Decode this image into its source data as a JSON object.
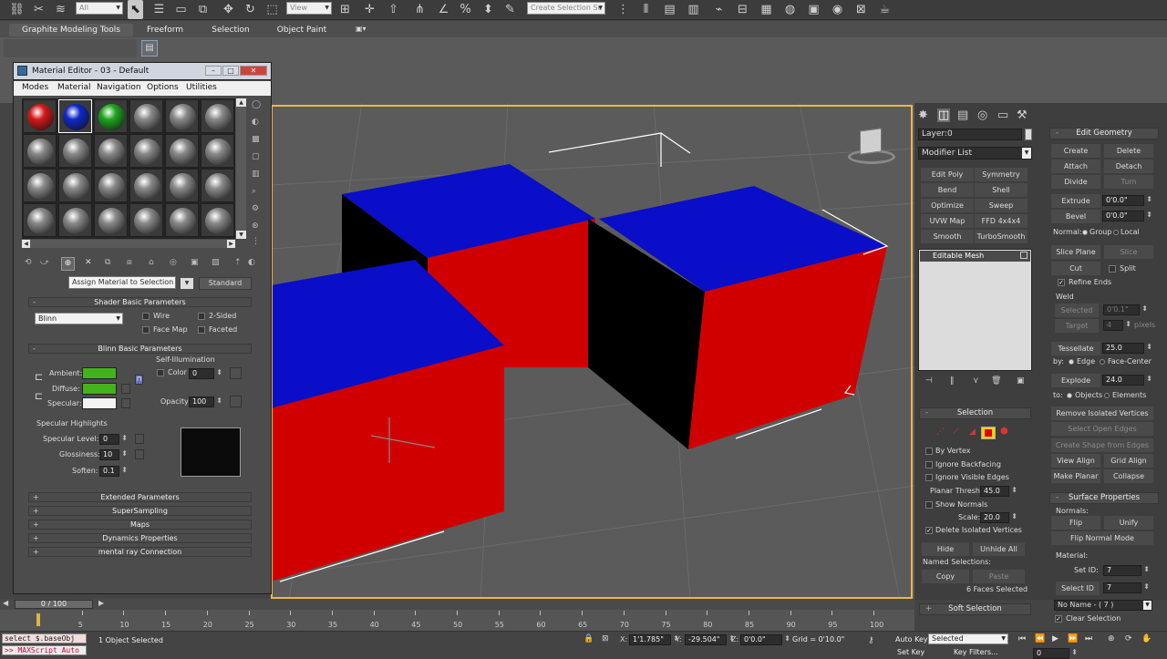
{
  "toolbar": {
    "selection_filter": "All",
    "ref_coord": "View",
    "named_selection": "Create Selection Se"
  },
  "ribbon": {
    "tabs": [
      "Graphite Modeling Tools",
      "Freeform",
      "Selection",
      "Object Paint"
    ]
  },
  "material_editor": {
    "title": "Material Editor - 03 - Default",
    "menu": [
      "Modes",
      "Material",
      "Navigation",
      "Options",
      "Utilities"
    ],
    "slot_colors": [
      "#d41a1a",
      "#1028c8",
      "#1ea81e"
    ],
    "tooltip": "Assign Material to Selection",
    "material_type": "Standard",
    "shader_params": {
      "header": "Shader Basic Parameters",
      "shader": "Blinn",
      "wire": "Wire",
      "two_sided": "2-Sided",
      "face_map": "Face Map",
      "faceted": "Faceted"
    },
    "blinn_params": {
      "header": "Blinn Basic Parameters",
      "self_illum": "Self-Illumination",
      "color_label": "Color",
      "color_value": "0",
      "ambient": "Ambient:",
      "diffuse": "Diffuse:",
      "specular": "Specular:",
      "opacity_label": "Opacity:",
      "opacity_value": "100",
      "ambient_color": "#44b21b",
      "diffuse_color": "#44b21b",
      "specular_color": "#f2f2f2"
    },
    "specular_highlights": {
      "header": "Specular Highlights",
      "level_label": "Specular Level:",
      "level_value": "0",
      "gloss_label": "Glossiness:",
      "gloss_value": "10",
      "soften_label": "Soften:",
      "soften_value": "0.1"
    },
    "rollouts": [
      "Extended Parameters",
      "SuperSampling",
      "Maps",
      "Dynamics Properties",
      "mental ray Connection"
    ]
  },
  "command_panel": {
    "layer": "Layer:0",
    "modifier_list": "Modifier List",
    "modifier_buttons": [
      "Edit Poly",
      "Symmetry",
      "Bend",
      "Shell",
      "Optimize",
      "Sweep",
      "UVW Map",
      "FFD 4x4x4",
      "Smooth",
      "TurboSmooth"
    ],
    "stack_item": "Editable Mesh",
    "selection": {
      "header": "Selection",
      "by_vertex": "By Vertex",
      "ignore_backfacing": "Ignore Backfacing",
      "ignore_visible_edges": "Ignore Visible Edges",
      "planar_thresh_label": "Planar Thresh:",
      "planar_thresh_value": "45.0",
      "show_normals": "Show Normals",
      "scale_label": "Scale:",
      "scale_value": "20.0",
      "delete_isolated": "Delete Isolated Vertices",
      "hide": "Hide",
      "unhide_all": "Unhide All",
      "named_selections": "Named Selections:",
      "copy": "Copy",
      "paste": "Paste",
      "status": "6 Faces Selected"
    },
    "soft_selection": "Soft Selection",
    "edit_geometry": {
      "header": "Edit Geometry",
      "create": "Create",
      "delete": "Delete",
      "attach": "Attach",
      "detach": "Detach",
      "divide": "Divide",
      "turn": "Turn",
      "extrude": "Extrude",
      "extrude_value": "0'0.0\"",
      "bevel": "Bevel",
      "bevel_value": "0'0.0\"",
      "normal_label": "Normal:",
      "group": "Group",
      "local": "Local",
      "slice_plane": "Slice Plane",
      "slice": "Slice",
      "cut": "Cut",
      "split": "Split",
      "refine_ends": "Refine Ends",
      "weld_label": "Weld",
      "selected": "Selected",
      "selected_value": "0'0.1\"",
      "target": "Target",
      "target_value": "4",
      "pixels": "pixels",
      "tessellate": "Tessellate",
      "tessellate_value": "25.0",
      "by_label": "by:",
      "edge": "Edge",
      "face_center": "Face-Center",
      "explode": "Explode",
      "explode_value": "24.0",
      "to_label": "to:",
      "objects": "Objects",
      "elements": "Elements",
      "remove_isolated": "Remove Isolated Vertices",
      "select_open_edges": "Select Open Edges",
      "create_shape": "Create Shape from Edges",
      "view_align": "View Align",
      "grid_align": "Grid Align",
      "make_planar": "Make Planar",
      "collapse": "Collapse"
    },
    "surface_properties": {
      "header": "Surface Properties",
      "normals": "Normals:",
      "flip": "Flip",
      "unify": "Unify",
      "flip_normal_mode": "Flip Normal Mode",
      "material": "Material:",
      "set_id_label": "Set ID:",
      "set_id_value": "7",
      "select_id_label": "Select ID",
      "select_id_value": "7",
      "name_select": "No Name - ( 7 )",
      "clear_selection": "Clear Selection"
    }
  },
  "timeline": {
    "frame": "0 / 100",
    "ticks": [
      "5",
      "10",
      "15",
      "20",
      "25",
      "30",
      "35",
      "40",
      "45",
      "50",
      "55",
      "60",
      "65",
      "70",
      "75",
      "80",
      "85",
      "90",
      "95",
      "100"
    ]
  },
  "status": {
    "script_1": "select $.baseObj",
    "script_2": ">> MAXScript Auto",
    "objects_selected": "1 Object Selected",
    "x_label": "X:",
    "x_value": "1'1.785\"",
    "y_label": "Y:",
    "y_value": "-29.504\"",
    "z_label": "Z:",
    "z_value": "0'0.0\"",
    "grid": "Grid = 0'10.0\"",
    "auto_key": "Auto Key",
    "selected": "Selected",
    "set_key": "Set Key",
    "key_filters": "Key Filters...",
    "current_frame": "0"
  }
}
